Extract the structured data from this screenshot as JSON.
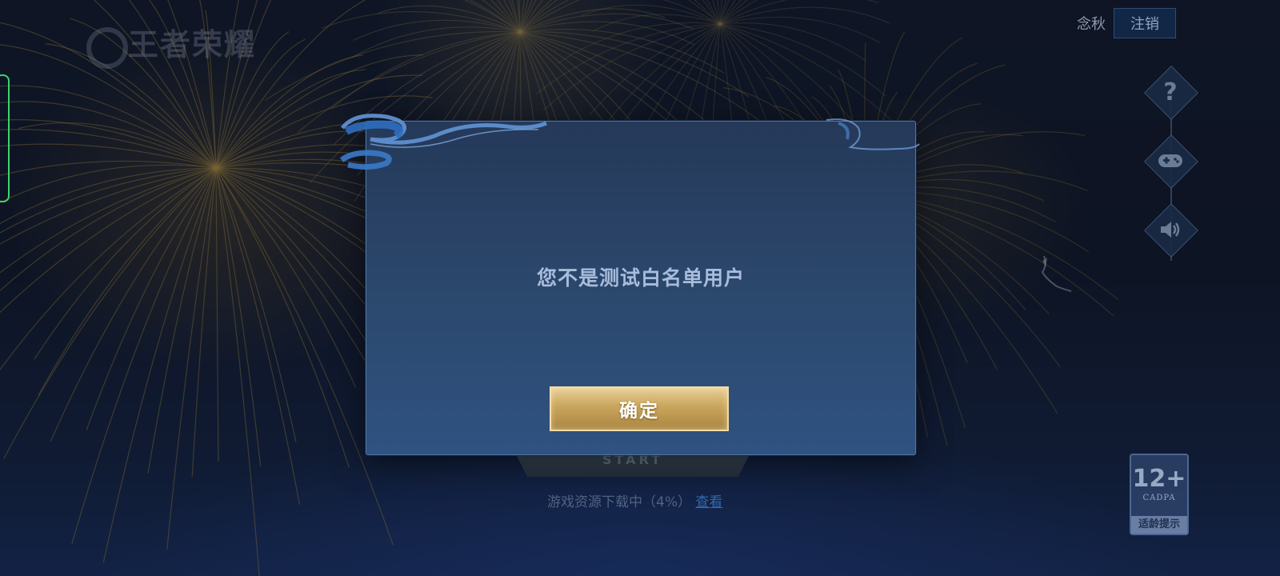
{
  "header": {
    "username": "念秋",
    "logout_label": "注销"
  },
  "logo": {
    "text": "王者荣耀"
  },
  "side_icons": [
    "help-icon",
    "gamepad-icon",
    "speaker-icon"
  ],
  "start_button": {
    "label": "START"
  },
  "download": {
    "status": "游戏资源下载中（4%）",
    "link": "查看"
  },
  "age_badge": {
    "rating": "12+",
    "org": "CADPA",
    "label": "适龄提示"
  },
  "modal": {
    "message": "您不是测试白名单用户",
    "confirm_label": "确定"
  },
  "colors": {
    "modal_bg": "#2c4a70",
    "confirm_gold": "#c9a55c",
    "message_text": "#a8bcdc"
  }
}
